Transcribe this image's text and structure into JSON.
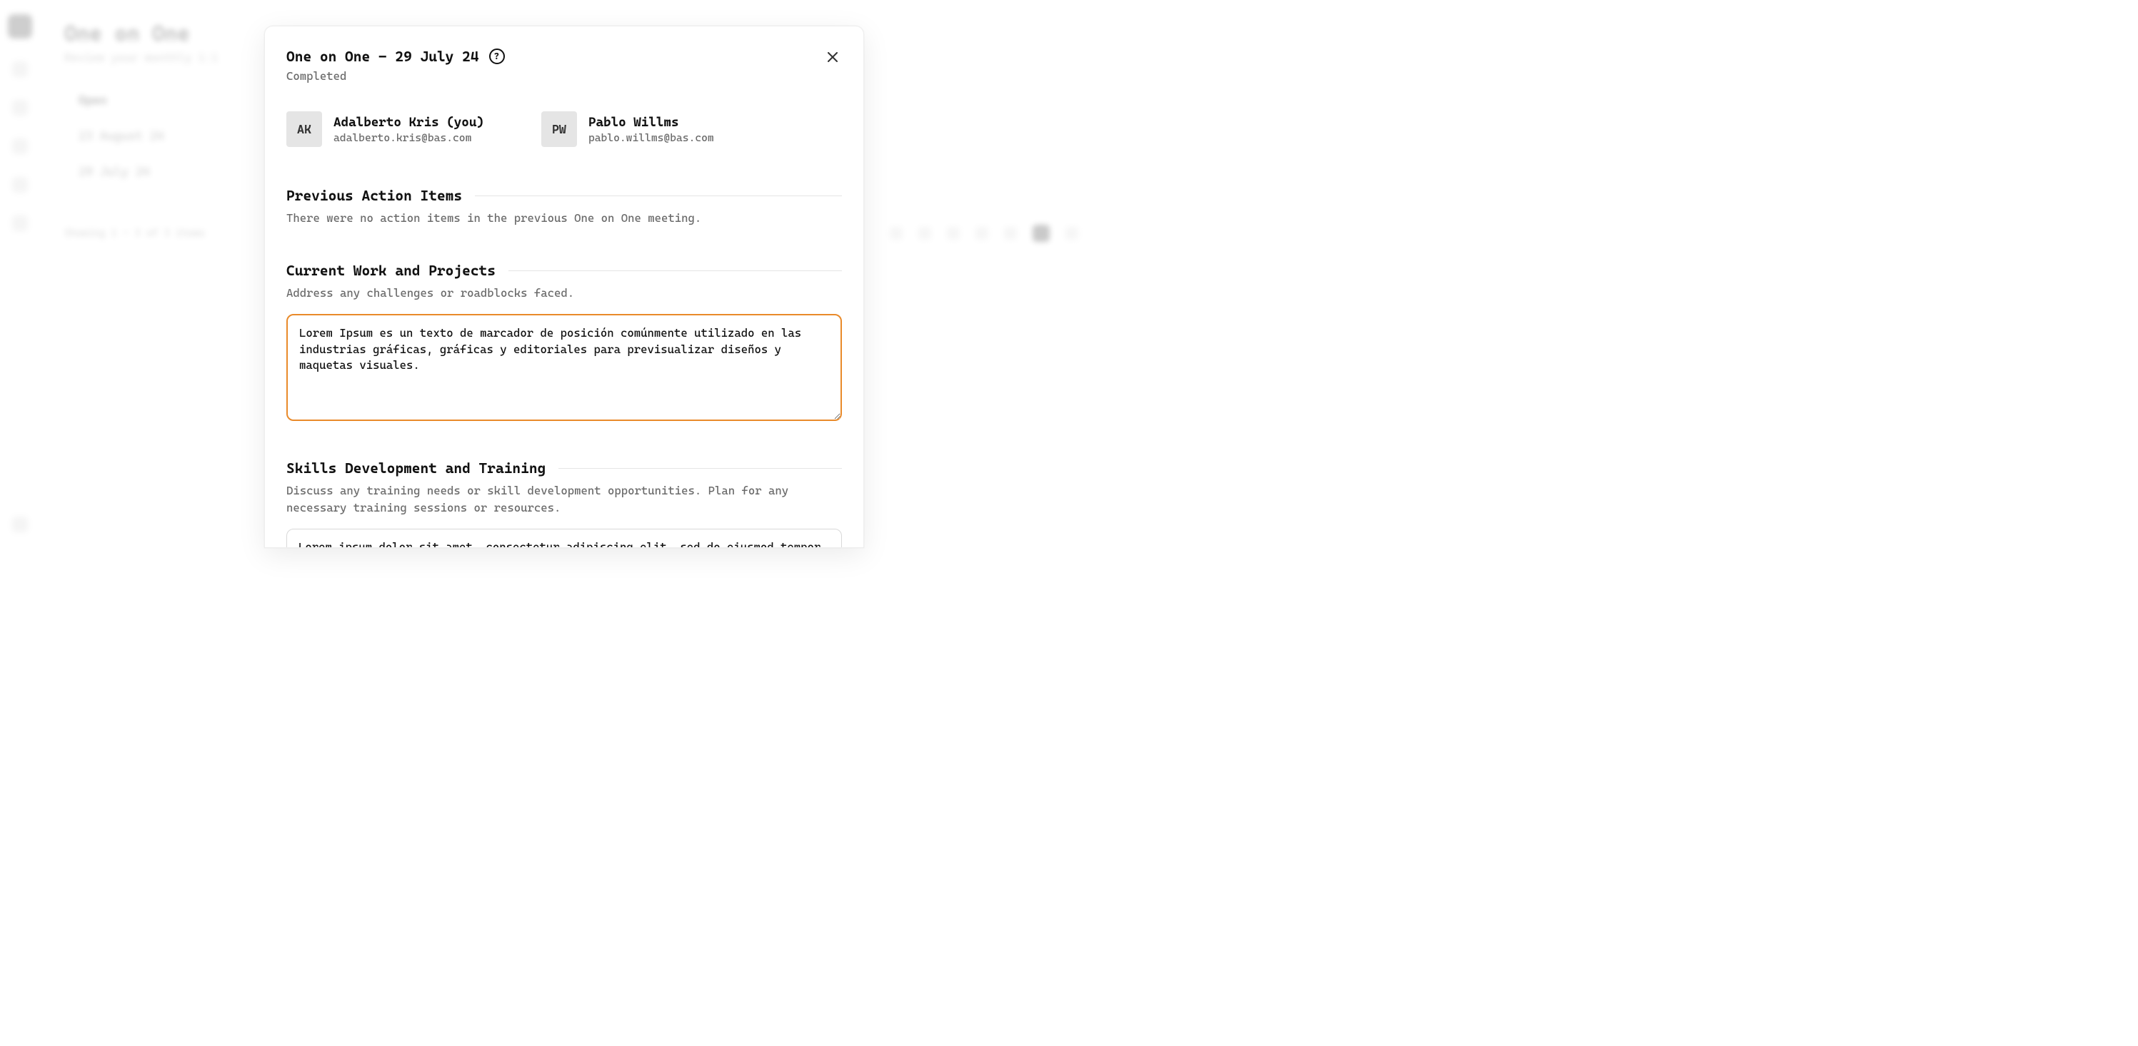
{
  "background": {
    "title": "One on One",
    "subtitle": "Review your monthly 1:1",
    "tabs": [
      "Open",
      "23 August 24",
      "29 July 24"
    ],
    "footer_left": "Showing 1 – 3 of 3 items"
  },
  "modal": {
    "title": "One on One - 29 July 24",
    "status": "Completed",
    "participants": [
      {
        "initials": "AK",
        "name": "Adalberto Kris (you)",
        "email": "adalberto.kris@bas.com"
      },
      {
        "initials": "PW",
        "name": "Pablo Willms",
        "email": "pablo.willms@bas.com"
      }
    ],
    "sections": {
      "previous": {
        "heading": "Previous Action Items",
        "desc": "There were no action items in the previous One on One meeting."
      },
      "current": {
        "heading": "Current Work and Projects",
        "desc": "Address any challenges or roadblocks faced.",
        "value": "Lorem Ipsum es un texto de marcador de posición comúnmente utilizado en las industrias gráficas, gráficas y editoriales para previsualizar diseños y maquetas visuales."
      },
      "skills": {
        "heading": "Skills Development and Training",
        "desc": "Discuss any training needs or skill development opportunities. Plan for any necessary training sessions or resources.",
        "value": "Lorem ipsum dolor sit amet, consectetur adipiscing elit, sed do eiusmod tempor"
      }
    }
  }
}
